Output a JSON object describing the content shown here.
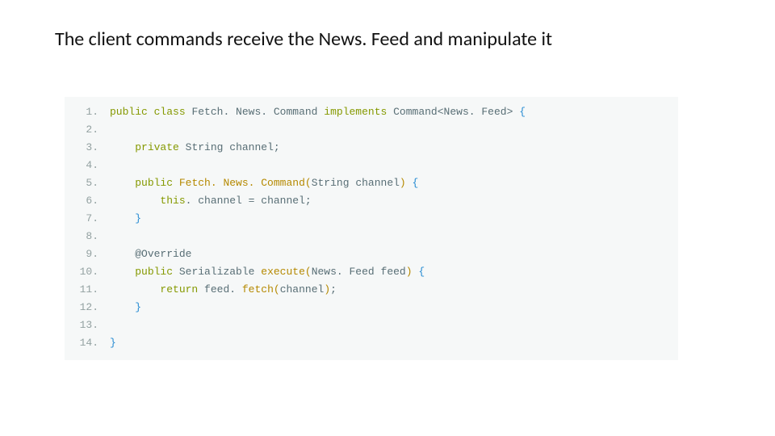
{
  "heading": "The client commands receive the News. Feed and manipulate it",
  "code": {
    "line_count": 14,
    "lines": [
      {
        "n": "1.",
        "tokens": [
          {
            "c": "kw",
            "t": "public"
          },
          {
            "c": "punc",
            "t": " "
          },
          {
            "c": "kw",
            "t": "class"
          },
          {
            "c": "punc",
            "t": " "
          },
          {
            "c": "type",
            "t": "Fetch. News. Command"
          },
          {
            "c": "punc",
            "t": " "
          },
          {
            "c": "kw",
            "t": "implements"
          },
          {
            "c": "punc",
            "t": " "
          },
          {
            "c": "type",
            "t": "Command"
          },
          {
            "c": "angle",
            "t": "<"
          },
          {
            "c": "type",
            "t": "News. Feed"
          },
          {
            "c": "angle",
            "t": ">"
          },
          {
            "c": "punc",
            "t": " "
          },
          {
            "c": "brace",
            "t": "{"
          }
        ]
      },
      {
        "n": "2.",
        "tokens": []
      },
      {
        "n": "3.",
        "tokens": [
          {
            "c": "punc",
            "t": "    "
          },
          {
            "c": "kw",
            "t": "private"
          },
          {
            "c": "punc",
            "t": " "
          },
          {
            "c": "type",
            "t": "String"
          },
          {
            "c": "punc",
            "t": " "
          },
          {
            "c": "type",
            "t": "channel"
          },
          {
            "c": "punc",
            "t": ";"
          }
        ]
      },
      {
        "n": "4.",
        "tokens": []
      },
      {
        "n": "5.",
        "tokens": [
          {
            "c": "punc",
            "t": "    "
          },
          {
            "c": "kw",
            "t": "public"
          },
          {
            "c": "punc",
            "t": " "
          },
          {
            "c": "fn",
            "t": "Fetch. News. Command"
          },
          {
            "c": "paren",
            "t": "("
          },
          {
            "c": "type",
            "t": "String"
          },
          {
            "c": "punc",
            "t": " "
          },
          {
            "c": "type",
            "t": "channel"
          },
          {
            "c": "paren",
            "t": ")"
          },
          {
            "c": "punc",
            "t": " "
          },
          {
            "c": "brace",
            "t": "{"
          }
        ]
      },
      {
        "n": "6.",
        "tokens": [
          {
            "c": "punc",
            "t": "        "
          },
          {
            "c": "kw",
            "t": "this"
          },
          {
            "c": "punc",
            "t": ". "
          },
          {
            "c": "type",
            "t": "channel"
          },
          {
            "c": "punc",
            "t": " = "
          },
          {
            "c": "type",
            "t": "channel"
          },
          {
            "c": "punc",
            "t": ";"
          }
        ]
      },
      {
        "n": "7.",
        "tokens": [
          {
            "c": "punc",
            "t": "    "
          },
          {
            "c": "brace",
            "t": "}"
          }
        ]
      },
      {
        "n": "8.",
        "tokens": []
      },
      {
        "n": "9.",
        "tokens": [
          {
            "c": "punc",
            "t": "    "
          },
          {
            "c": "ann",
            "t": "@Override"
          }
        ]
      },
      {
        "n": "10.",
        "tokens": [
          {
            "c": "punc",
            "t": "    "
          },
          {
            "c": "kw",
            "t": "public"
          },
          {
            "c": "punc",
            "t": " "
          },
          {
            "c": "type",
            "t": "Serializable"
          },
          {
            "c": "punc",
            "t": " "
          },
          {
            "c": "fn",
            "t": "execute"
          },
          {
            "c": "paren",
            "t": "("
          },
          {
            "c": "type",
            "t": "News. Feed"
          },
          {
            "c": "punc",
            "t": " "
          },
          {
            "c": "type",
            "t": "feed"
          },
          {
            "c": "paren",
            "t": ")"
          },
          {
            "c": "punc",
            "t": " "
          },
          {
            "c": "brace",
            "t": "{"
          }
        ]
      },
      {
        "n": "11.",
        "tokens": [
          {
            "c": "punc",
            "t": "        "
          },
          {
            "c": "kw",
            "t": "return"
          },
          {
            "c": "punc",
            "t": " "
          },
          {
            "c": "type",
            "t": "feed"
          },
          {
            "c": "punc",
            "t": ". "
          },
          {
            "c": "fn",
            "t": "fetch"
          },
          {
            "c": "paren",
            "t": "("
          },
          {
            "c": "type",
            "t": "channel"
          },
          {
            "c": "paren",
            "t": ")"
          },
          {
            "c": "punc",
            "t": ";"
          }
        ]
      },
      {
        "n": "12.",
        "tokens": [
          {
            "c": "punc",
            "t": "    "
          },
          {
            "c": "brace",
            "t": "}"
          }
        ]
      },
      {
        "n": "13.",
        "tokens": []
      },
      {
        "n": "14.",
        "tokens": [
          {
            "c": "brace",
            "t": "}"
          }
        ]
      }
    ]
  }
}
